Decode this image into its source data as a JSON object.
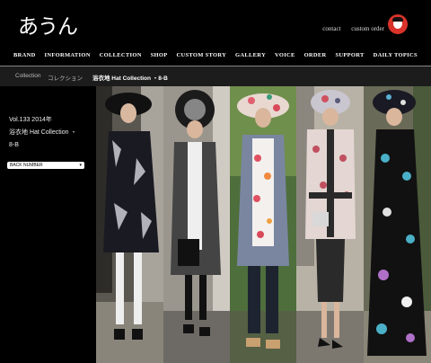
{
  "header": {
    "logo_text": "あうん",
    "links": [
      "contact",
      "custom order"
    ],
    "accent": "#d9332b"
  },
  "nav": [
    "BRAND",
    "INFORMATION",
    "COLLECTION",
    "SHOP",
    "CUSTOM STORY",
    "GALLERY",
    "VOICE",
    "ORDER",
    "SUPPORT",
    "DAILY TOPICS"
  ],
  "breadcrumb": {
    "items": [
      "Collection",
      "コレクション"
    ],
    "current": "浴衣地 Hat Collection ・8-B"
  },
  "sidebar": {
    "vol_line1": "Vol.133  2014年",
    "vol_line2": "浴衣地 Hat Collection ・",
    "vol_line3": "8-B",
    "select_value": "BACK NUMBER"
  },
  "photos": [
    {
      "name": "photo-model-1",
      "desc_icon": "photo-1"
    },
    {
      "name": "photo-model-2",
      "desc_icon": "photo-2"
    },
    {
      "name": "photo-model-3",
      "desc_icon": "photo-3"
    },
    {
      "name": "photo-model-4",
      "desc_icon": "photo-4"
    },
    {
      "name": "photo-model-5",
      "desc_icon": "photo-5"
    }
  ]
}
